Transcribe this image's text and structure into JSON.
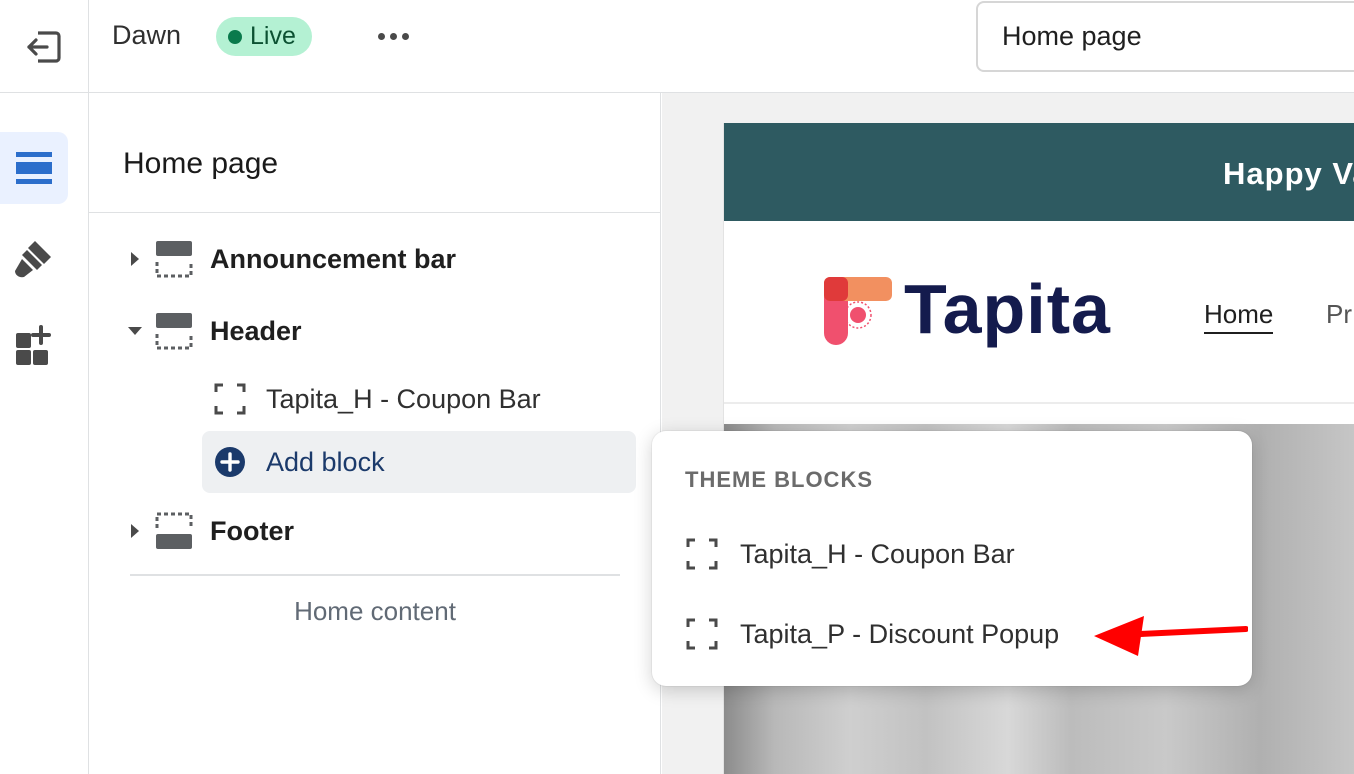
{
  "topbar": {
    "theme_name": "Dawn",
    "status_badge": "Live",
    "page_selector": "Home page"
  },
  "sidebar": {
    "title": "Home page",
    "sections": [
      {
        "label": "Announcement bar",
        "expanded": false
      },
      {
        "label": "Header",
        "expanded": true
      },
      {
        "label": "Footer",
        "expanded": false
      }
    ],
    "header_blocks": [
      {
        "label": "Tapita_H - Coupon Bar"
      }
    ],
    "add_block_label": "Add block",
    "home_content_label": "Home content"
  },
  "preview": {
    "announcement_text": "Happy Va",
    "logo_text": "Tapita",
    "nav": {
      "home": "Home",
      "more": "Pr"
    }
  },
  "popover": {
    "heading": "THEME BLOCKS",
    "items": [
      {
        "label": "Tapita_H - Coupon Bar"
      },
      {
        "label": "Tapita_P - Discount Popup"
      }
    ]
  },
  "colors": {
    "live_badge_bg": "#b4f1d3",
    "live_dot": "#0a7a4c",
    "active_rail_bg": "#eaf1ff",
    "announcement_bg": "#2e5a61",
    "logo_text": "#141b4d",
    "add_block_icon": "#1b3a6b",
    "annotation_arrow": "#ff0000"
  }
}
